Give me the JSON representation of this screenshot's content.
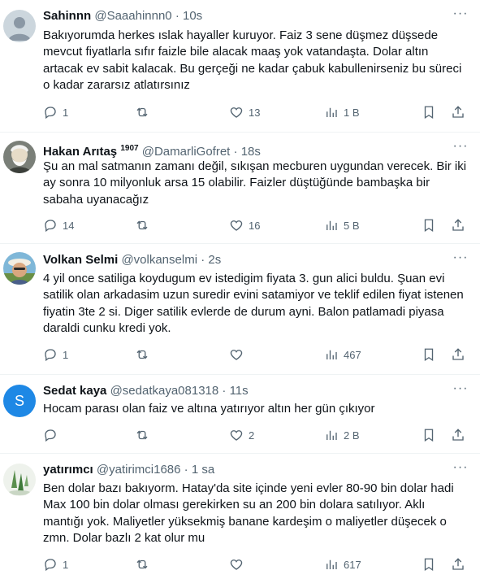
{
  "tweets": [
    {
      "name": "Sahinnn",
      "badge": "",
      "handle": "@Saaahinnn0",
      "dot": "·",
      "time": "10s",
      "text": "Bakıyorumda herkes ıslak hayaller kuruyor. Faiz 3 sene düşmez düşsede mevcut fiyatlarla sıfır faizle bile alacak maaş yok vatandaşta. Dolar altın artacak ev sabit kalacak. Bu gerçeği ne kadar çabuk kabullenirseniz bu süreci o kadar zararsız atlatırsınız",
      "replies": "1",
      "retweets": "",
      "likes": "13",
      "views": "1 B",
      "avatar_color": "#ccd6dd"
    },
    {
      "name": "Hakan Arıtaş",
      "badge": "1907",
      "handle": "@DamarliGofret",
      "dot": "·",
      "time": "18s",
      "text": "Şu an mal satmanın zamanı değil, sıkışan mecburen uygundan verecek. Bir iki ay sonra 10 milyonluk arsa 15 olabilir. Faizler düştüğünde bambaşka bir sabaha uyanacağız",
      "replies": "14",
      "retweets": "",
      "likes": "16",
      "views": "5 B",
      "avatar_color": "#8a8f86"
    },
    {
      "name": "Volkan Selmi",
      "badge": "",
      "handle": "@volkanselmi",
      "dot": "·",
      "time": "2s",
      "text": "4 yil once satiliga koydugum ev istedigim fiyata 3. gun alici buldu. Şuan evi satilik olan arkadasim  uzun suredir evini satamiyor ve teklif edilen fiyat istenen fiyatin 3te 2 si. Diger satilik evlerde de durum ayni. Balon patlamadi piyasa daraldi cunku kredi yok.",
      "replies": "1",
      "retweets": "",
      "likes": "",
      "views": "467",
      "avatar_color": "#7fb7d8"
    },
    {
      "name": "Sedat kaya",
      "badge": "",
      "handle": "@sedatkaya081318",
      "dot": "·",
      "time": "11s",
      "text": "Hocam  parası olan  faiz ve altına yatırıyor altın her gün  çıkıyor",
      "replies": "",
      "retweets": "",
      "likes": "2",
      "views": "2 B",
      "avatar_color": "#1e88e5",
      "avatar_letter": "S"
    },
    {
      "name": "yatırımcı",
      "badge": "",
      "handle": "@yatirimci1686",
      "dot": "·",
      "time": "1 sa",
      "text": "Ben dolar bazı bakıyorm. Hatay'da site içinde yeni evler 80-90 bin dolar hadi Max 100 bin dolar olması gerekirken su an 200 bin dolara satılıyor. Aklı mantığı yok. Maliyetler yüksekmiş banane kardeşim o maliyetler düşecek o zmn. Dolar bazlı 2 kat olur mu",
      "replies": "1",
      "retweets": "",
      "likes": "",
      "views": "617",
      "avatar_color": "#e8efe6"
    }
  ],
  "icons": {
    "more": "more-dots-icon",
    "reply": "reply-icon",
    "retweet": "retweet-icon",
    "like": "heart-icon",
    "views": "views-chart-icon",
    "bookmark": "bookmark-icon",
    "share": "share-icon"
  }
}
